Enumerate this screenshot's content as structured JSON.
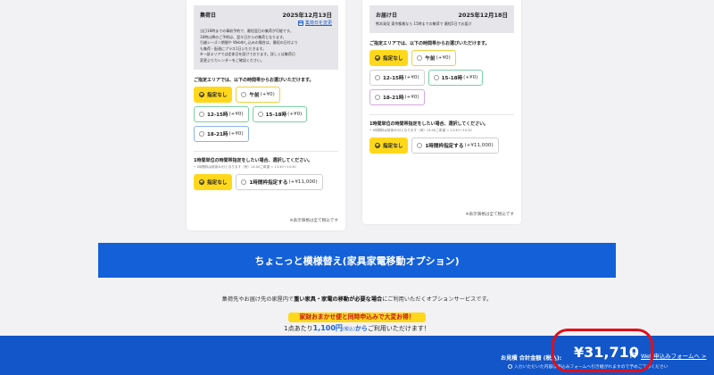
{
  "left_card": {
    "title": "集荷日",
    "date": "2025年12月13日",
    "link": "集荷日を変更",
    "body": [
      "当日18時までの事前予約で、最短翌日の集荷が可能です。",
      "18時以降のご予約は、翌々日からの集荷となります。",
      "引越シーズン期間や Web申し込みの場合は、最短の日付より",
      "も集荷・配達にプラス1日いただきます。",
      "※一部エリアでは定休日を設けております。詳しくは集荷日",
      "変更よりカレンダーをご確認ください。"
    ],
    "time_label": "ご指定エリアでは、以下の時間帯からお選びいただけます。",
    "time_options": [
      {
        "label": "指定なし",
        "price": ""
      },
      {
        "label": "午前",
        "price": "(+¥0)"
      },
      {
        "label": "12-15時",
        "price": "(+¥0)"
      },
      {
        "label": "15-18時",
        "price": "(+¥0)"
      },
      {
        "label": "18-21時",
        "price": "(+¥0)"
      }
    ],
    "hourly_label": "1時間単位の時間帯指定をしたい場合、選択してください。",
    "hourly_note": "• 1時間枠は前後30分となります（例）14:00ご希望 = 13:30〜14:30",
    "hourly_options": [
      {
        "label": "指定なし",
        "price": ""
      },
      {
        "label": "1時間枠指定する",
        "price": "(+¥11,000)"
      }
    ],
    "tax_note": "※表示価格は全て税込です"
  },
  "right_card": {
    "title": "お届け日",
    "date": "2025年12月18日",
    "body": [
      "熊本発見 東京都着なら 15時までの集荷で 最短5日でお届け"
    ],
    "time_label": "ご指定エリアでは、以下の時間帯からお選びいただけます。",
    "time_options": [
      {
        "label": "指定なし",
        "price": ""
      },
      {
        "label": "午前",
        "price": "(+¥0)"
      },
      {
        "label": "12-15時",
        "price": "(+¥0)"
      },
      {
        "label": "15-18時",
        "price": "(+¥0)"
      },
      {
        "label": "18-21時",
        "price": "(+¥0)"
      }
    ],
    "hourly_label": "1時間単位の時間帯指定をしたい場合、選択してください。",
    "hourly_note": "• 1時間枠は前後30分となります（例）14:00ご希望 = 13:30〜14:30",
    "hourly_options": [
      {
        "label": "指定なし",
        "price": ""
      },
      {
        "label": "1時間枠指定する",
        "price": "(+¥11,000)"
      }
    ],
    "tax_note": "※表示価格は全て税込です"
  },
  "banner": {
    "title": "ちょこっと模様替え(家具家電移動オプション)"
  },
  "option_desc": {
    "pre": "集荷先やお届け先の家屋内で",
    "bold": "重い家具・家電の移動が必要な場合",
    "post": "にご利用いただくオプションサービスです。"
  },
  "pill": "家財おまかせ便と同時申込みで大変お得！",
  "per": {
    "pre": "1点あたり",
    "amount": "1,100円",
    "tax": "(税込)",
    "kara": "から",
    "post": "ご利用いただけます！"
  },
  "footer": {
    "total_label": "お見積 合計金額 (税込):",
    "total_amount": "¥31,710",
    "unit": "円",
    "web_link": "Web申込みフォームへ >",
    "note": "入力いただいた内容は申込みフォームへ引き継がれますので予めご了承ください"
  },
  "colors": {
    "accent_blue": "#1360d9",
    "footer_blue": "#1256c9",
    "selected_yellow": "#ffd81c",
    "highlight_red": "#e0101a"
  }
}
